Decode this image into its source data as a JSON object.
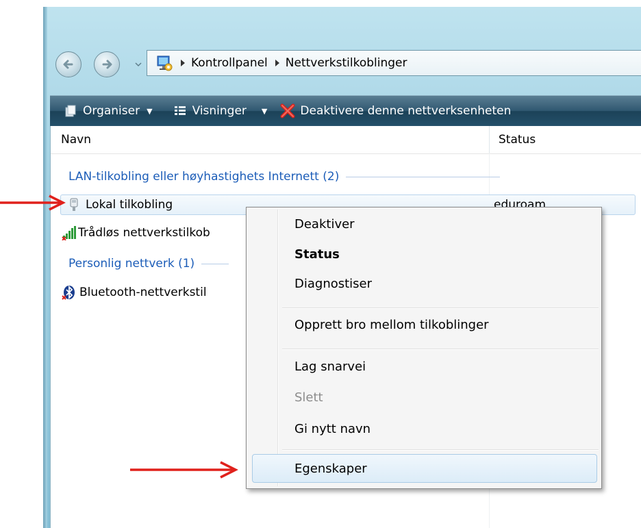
{
  "address": {
    "crumbs": [
      "Kontrollpanel",
      "Nettverkstilkoblinger"
    ]
  },
  "toolbar": {
    "organize_label": "Organiser",
    "views_label": "Visninger",
    "disable_label": "Deaktivere denne nettverksenheten"
  },
  "columns": {
    "name": "Navn",
    "status": "Status"
  },
  "groups": [
    {
      "title": "LAN-tilkobling eller høyhastighets Internett (2)"
    },
    {
      "title": "Personlig nettverk (1)"
    }
  ],
  "items": [
    {
      "name": "Lokal tilkobling",
      "status": "eduroam",
      "icon": "ethernet-icon"
    },
    {
      "name": "Trådløs nettverkstilkob",
      "icon": "wireless-icon"
    },
    {
      "name": "Bluetooth-nettverkstil",
      "icon": "bluetooth-icon"
    }
  ],
  "context_menu": {
    "items": [
      {
        "label": "Deaktiver"
      },
      {
        "label": "Status"
      },
      {
        "label": "Diagnostiser"
      },
      {
        "label": "Opprett bro mellom tilkoblinger"
      },
      {
        "label": "Lag snarvei"
      },
      {
        "label": "Slett"
      },
      {
        "label": "Gi nytt navn"
      },
      {
        "label": "Egenskaper"
      }
    ]
  },
  "colors": {
    "accent": "#1c5db8",
    "arrow": "#e0211c"
  }
}
